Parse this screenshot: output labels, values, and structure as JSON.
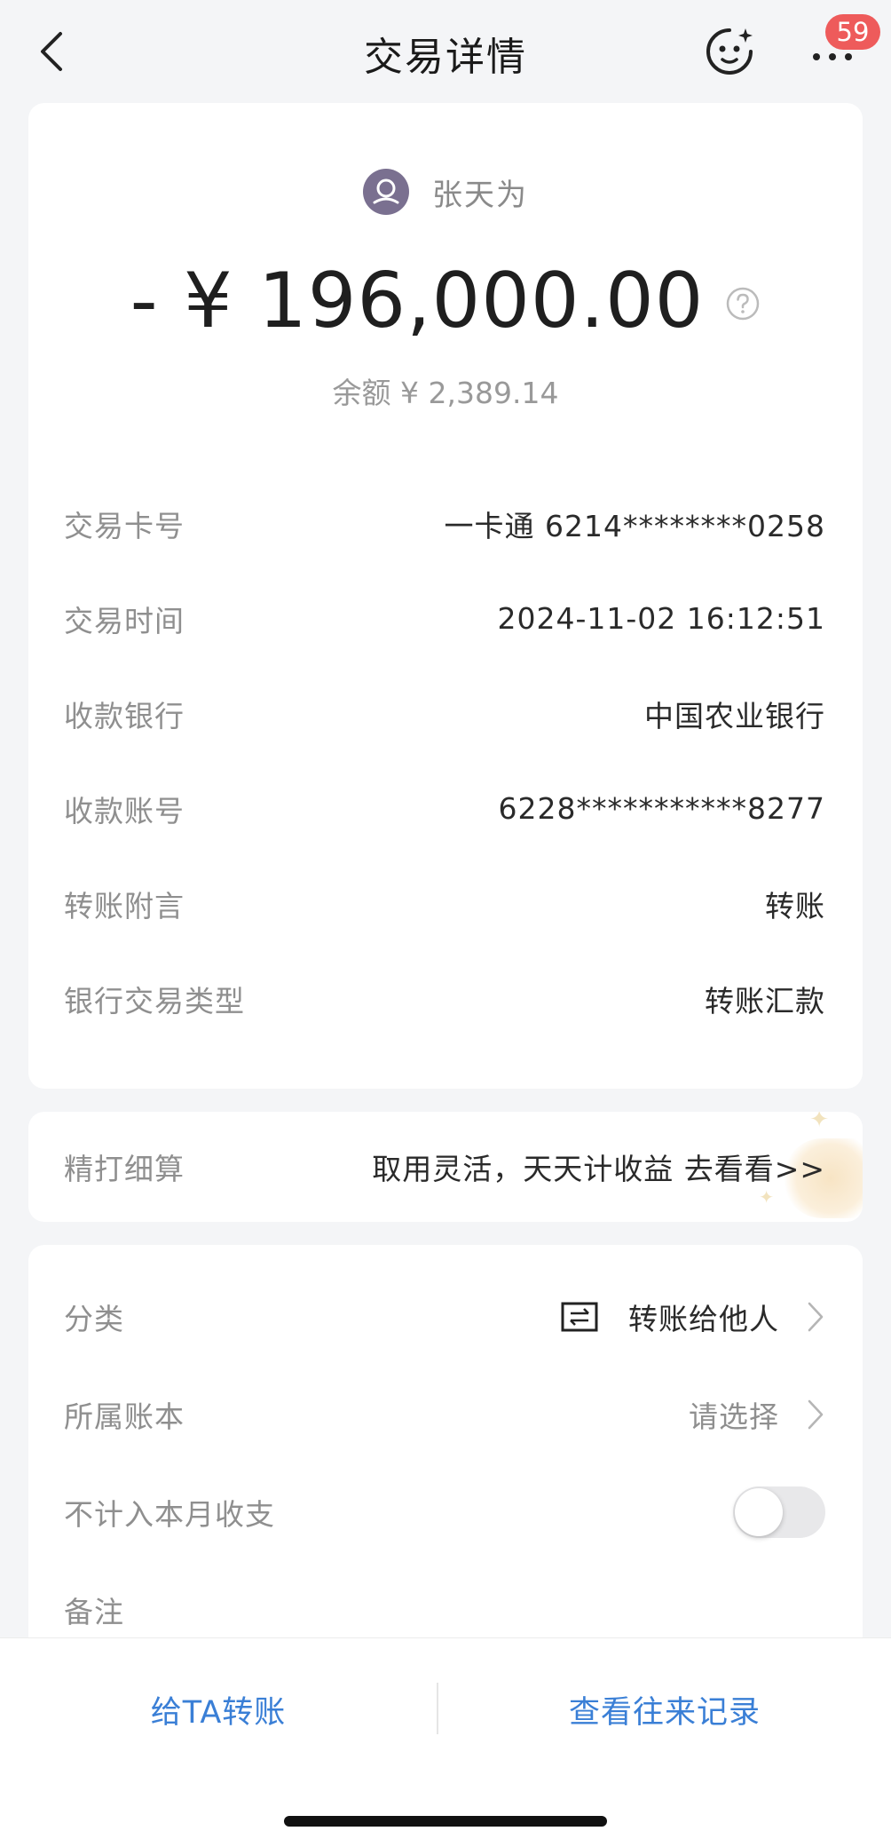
{
  "header": {
    "title": "交易详情",
    "badge_count": "59"
  },
  "summary": {
    "payee_name": "张天为",
    "amount": "- ¥ 196,000.00",
    "balance": "余额 ¥ 2,389.14"
  },
  "details": [
    {
      "label": "交易卡号",
      "value": "一卡通 6214********0258"
    },
    {
      "label": "交易时间",
      "value": "2024-11-02 16:12:51"
    },
    {
      "label": "收款银行",
      "value": "中国农业银行"
    },
    {
      "label": "收款账号",
      "value": "6228***********8277"
    },
    {
      "label": "转账附言",
      "value": "转账"
    },
    {
      "label": "银行交易类型",
      "value": "转账汇款"
    }
  ],
  "promo": {
    "label": "精打细算",
    "text": "取用灵活，天天计收益 去看看>>"
  },
  "settings": {
    "category_label": "分类",
    "category_value": "转账给他人",
    "book_label": "所属账本",
    "book_value": "请选择",
    "exclude_label": "不计入本月收支",
    "exclude_on": false,
    "note_label": "备注"
  },
  "footer": {
    "transfer_label": "给TA转账",
    "history_label": "查看往来记录"
  },
  "colors": {
    "accent": "#3a7fd6",
    "badge": "#ee5b5b",
    "avatar": "#7a7090"
  }
}
